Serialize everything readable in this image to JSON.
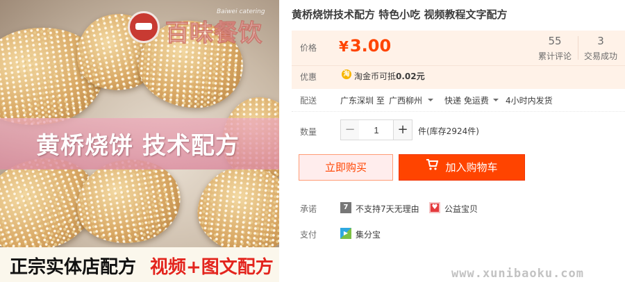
{
  "product_image": {
    "logo_text": "百味餐饮",
    "logo_subtext": "Baiwei catering",
    "banner_text": "黄桥烧饼 技术配方",
    "bottom_black_text": "正宗实体店配方",
    "bottom_red_text": "视频+图文配方"
  },
  "title": "黄桥烧饼技术配方 特色小吃 视频教程文字配方",
  "price": {
    "label": "价格",
    "currency": "¥",
    "amount": "3.00",
    "accent_color": "#ff4400"
  },
  "stats": [
    {
      "value": "55",
      "label": "累计评论"
    },
    {
      "value": "3",
      "label": "交易成功"
    }
  ],
  "promo": {
    "label": "优惠",
    "icon": "taojinbi-coin-icon",
    "icon_glyph": "淘",
    "text_prefix": "淘金币可抵",
    "text_amount": "0.02元"
  },
  "shipping": {
    "label": "配送",
    "origin": "广东深圳 至",
    "destination": "广西柳州",
    "method": "快递 免运费",
    "dispatch": "4小时内发货"
  },
  "quantity": {
    "label": "数量",
    "minus": "−",
    "value": "1",
    "plus": "+",
    "stock_text": "件(库存2924件)"
  },
  "actions": {
    "buy_now": "立即购买",
    "add_to_cart": "加入购物车"
  },
  "services": {
    "promise_label": "承诺",
    "promise_items": [
      {
        "icon": "no-7day-return-icon",
        "glyph": "7",
        "text": "不支持7天无理由"
      },
      {
        "icon": "charity-icon",
        "glyph": "♥",
        "text": "公益宝贝"
      }
    ],
    "payment_label": "支付",
    "payment_items": [
      {
        "icon": "jifenbao-icon",
        "glyph": "▶",
        "text": "集分宝"
      }
    ]
  },
  "watermark": "www.xunibaoku.com"
}
